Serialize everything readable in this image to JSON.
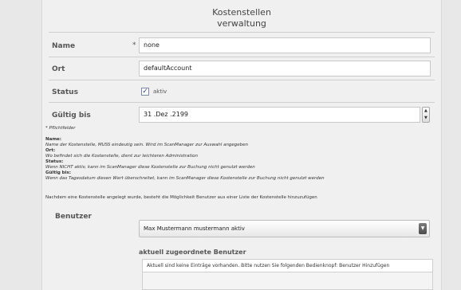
{
  "title": {
    "line1": "Kostenstellen",
    "line2": "verwaltung"
  },
  "form": {
    "name": {
      "label": "Name",
      "required": "*",
      "value": "none"
    },
    "ort": {
      "label": "Ort",
      "value": "defaultAccount"
    },
    "status": {
      "label": "Status",
      "checkbox_label": "aktiv",
      "checked": true,
      "check_glyph": "✓"
    },
    "gueltig": {
      "label": "Gültig bis",
      "value": "31 .Dez .2199",
      "spinner_up": "▲",
      "spinner_down": "▼"
    }
  },
  "notes": {
    "pflichtfelder": "* Pflichtfelder",
    "name_heading": "Name:",
    "name_text": "Name der Kostenstelle, MUSS eindeutig sein. Wird im ScanManager zur Auswahl angegeben",
    "ort_heading": "Ort:",
    "ort_text": "Wo befindet sich die Kostenstelle, dient zur leichteren Administration",
    "status_heading": "Status:",
    "status_text": "Wenn NICHT aktiv, kann im ScanManager diese Kostenstelle zur Buchung nicht genutzt werden",
    "gueltig_heading": "Gültig bis:",
    "gueltig_text": "Wenn das Tagesdatum diesen Wert überschreitet, kann im ScanManager diese Kostenstelle zur Buchung nicht genutzt werden",
    "info": "Nachdem eine Kostenstelle angelegt wurde, besteht die Möglichkeit Benutzer aus einer Liste der Kostenstelle hinzuzufügen"
  },
  "benutzer": {
    "label": "Benutzer",
    "selected": "Max  Mustermann   mustermann   aktiv",
    "dropdown_glyph": "▼",
    "assigned_title": "aktuell zugeordnete Benutzer",
    "empty_message": "Aktuell sind keine Einträge vorhanden. Bitte nutzen Sie folgenden Bedienknopf:  Benutzer Hinzufügen"
  }
}
